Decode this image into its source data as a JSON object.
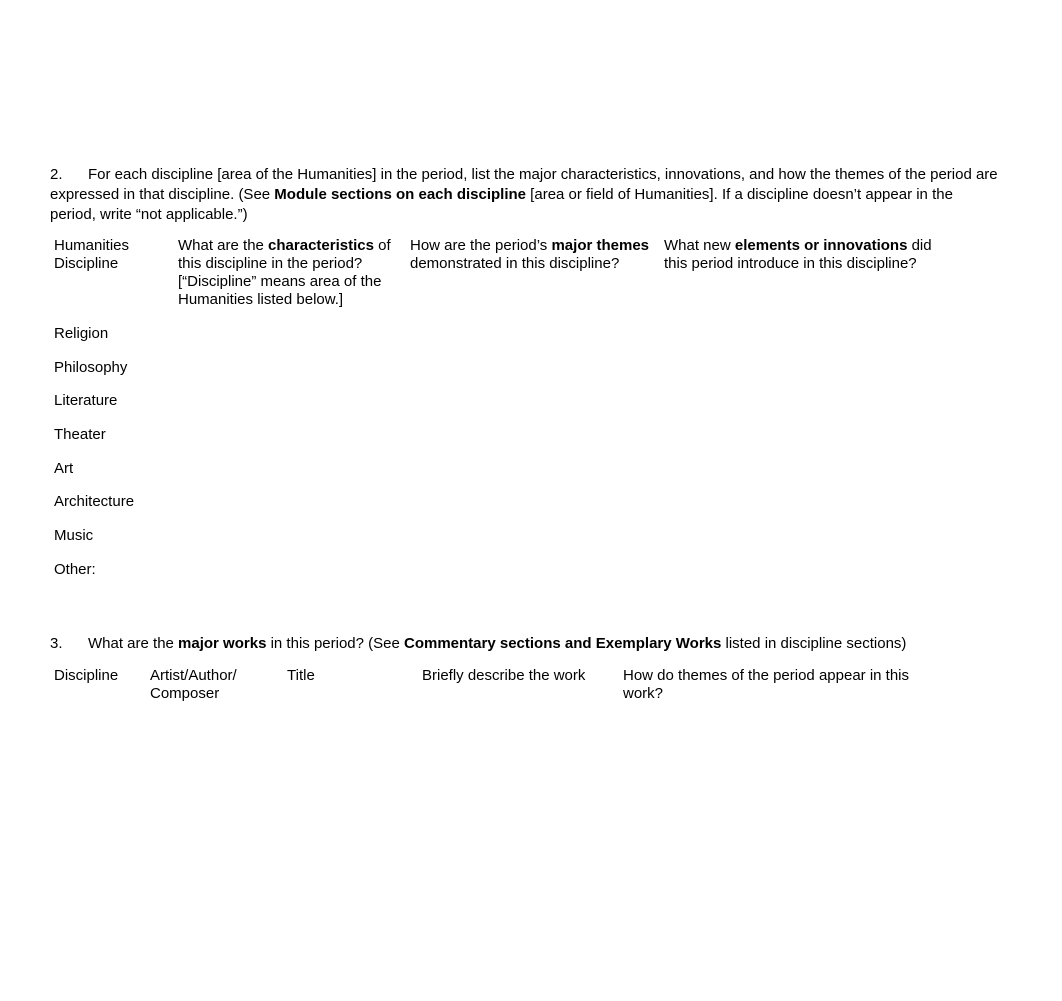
{
  "document": {
    "question_2": {
      "number": "2.",
      "line_parts": [
        "For each discipline [area of the Humanities] in the period, list the major characteristics, innovations, and how the themes of the period are expressed in that discipline.  (See ",
        "Module sections on each discipline",
        " [area or field of Humanities].  If a discipline doesn’t appear in the period, write “not applicable.”)"
      ],
      "bold_phrase": "Module sections on each discipline"
    },
    "question_3": {
      "number": "3.",
      "part_1": "What are the ",
      "bold_1": "major works",
      "part_2": " in this period?   (See ",
      "bold_2": "Commentary sections and Exemplary Works",
      "part_3": " listed in discipline sections)"
    },
    "disciplines_table": {
      "headers": [
        {
          "id": "humanities-discipline",
          "segments": [
            {
              "text": "Humanities Discipline",
              "bold": false
            }
          ]
        },
        {
          "id": "characteristics",
          "segments": [
            {
              "text": "What are the ",
              "bold": false
            },
            {
              "text": "characteristics",
              "bold": true
            },
            {
              "text": " of this discipline in the period? [“Discipline” means area of the Humanities listed below.]",
              "bold": false
            }
          ]
        },
        {
          "id": "major-themes",
          "segments": [
            {
              "text": "How are the period’s  ",
              "bold": false
            },
            {
              "text": "major themes",
              "bold": true
            },
            {
              "text": " demonstrated in this discipline?",
              "bold": false
            }
          ]
        },
        {
          "id": "elements-innovations",
          "segments": [
            {
              "text": "What new ",
              "bold": false
            },
            {
              "text": "elements or innovations",
              "bold": true
            },
            {
              "text": " did this period introduce in this discipline?",
              "bold": false
            }
          ]
        }
      ],
      "rows": [
        {
          "discipline": "Religion",
          "characteristics": "",
          "major_themes": "",
          "elements_innovations": ""
        },
        {
          "discipline": "Philosophy",
          "characteristics": "",
          "major_themes": "",
          "elements_innovations": ""
        },
        {
          "discipline": "Literature",
          "characteristics": "",
          "major_themes": "",
          "elements_innovations": ""
        },
        {
          "discipline": "Theater",
          "characteristics": "",
          "major_themes": "",
          "elements_innovations": ""
        },
        {
          "discipline": "Art",
          "characteristics": "",
          "major_themes": "",
          "elements_innovations": ""
        },
        {
          "discipline": "Architecture",
          "characteristics": "",
          "major_themes": "",
          "elements_innovations": ""
        },
        {
          "discipline": "Music",
          "characteristics": "",
          "major_themes": "",
          "elements_innovations": ""
        },
        {
          "discipline": "Other:",
          "characteristics": "",
          "major_themes": "",
          "elements_innovations": ""
        }
      ]
    },
    "works_table": {
      "headers": [
        "Discipline",
        "Artist/Author/ Composer",
        "Title",
        "Briefly describe the work",
        "How do themes of the period appear in this work?"
      ],
      "rows": [
        {
          "discipline": "",
          "artist": "",
          "title": "",
          "description": "",
          "themes": ""
        },
        {
          "discipline": "",
          "artist": "",
          "title": "",
          "description": "",
          "themes": ""
        },
        {
          "discipline": "",
          "artist": "",
          "title": "",
          "description": "",
          "themes": ""
        },
        {
          "discipline": "",
          "artist": "",
          "title": "",
          "description": "",
          "themes": ""
        }
      ]
    }
  }
}
